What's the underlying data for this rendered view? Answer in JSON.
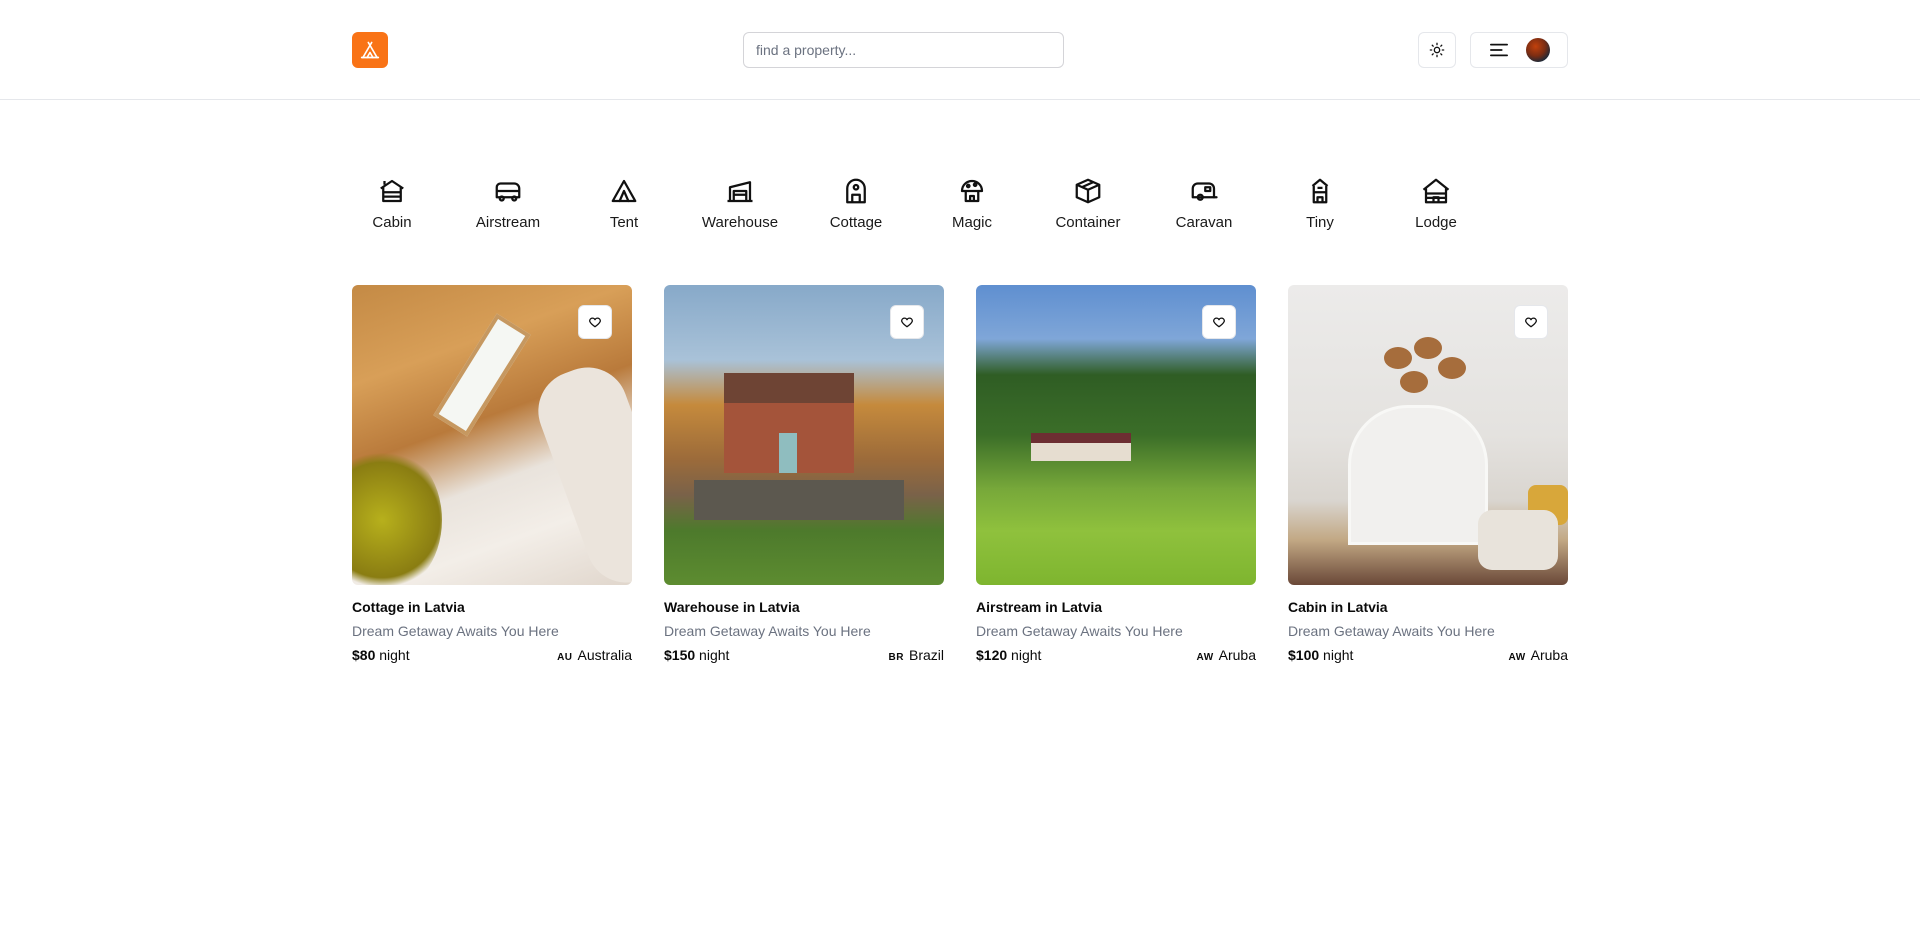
{
  "header": {
    "logo_icon": "tent-icon",
    "accent_color": "#f97316",
    "search": {
      "placeholder": "find a property..."
    },
    "theme_toggle_icon": "sun-icon",
    "menu_icon": "menu-lines-icon",
    "avatar_icon": "user-avatar"
  },
  "categories": [
    {
      "label": "Cabin",
      "icon": "cabin-icon"
    },
    {
      "label": "Airstream",
      "icon": "airstream-icon"
    },
    {
      "label": "Tent",
      "icon": "tent-icon"
    },
    {
      "label": "Warehouse",
      "icon": "warehouse-icon"
    },
    {
      "label": "Cottage",
      "icon": "cottage-icon"
    },
    {
      "label": "Magic",
      "icon": "magic-house-icon"
    },
    {
      "label": "Container",
      "icon": "container-icon"
    },
    {
      "label": "Caravan",
      "icon": "caravan-icon"
    },
    {
      "label": "Tiny",
      "icon": "tiny-house-icon"
    },
    {
      "label": "Lodge",
      "icon": "lodge-icon"
    }
  ],
  "properties": [
    {
      "title": "Cottage in Latvia",
      "tagline": "Dream Getaway Awaits You Here",
      "price": "$80",
      "price_unit": "night",
      "country_code": "AU",
      "country": "Australia",
      "favorite_icon": "heart-icon"
    },
    {
      "title": "Warehouse in Latvia",
      "tagline": "Dream Getaway Awaits You Here",
      "price": "$150",
      "price_unit": "night",
      "country_code": "BR",
      "country": "Brazil",
      "favorite_icon": "heart-icon"
    },
    {
      "title": "Airstream in Latvia",
      "tagline": "Dream Getaway Awaits You Here",
      "price": "$120",
      "price_unit": "night",
      "country_code": "AW",
      "country": "Aruba",
      "favorite_icon": "heart-icon"
    },
    {
      "title": "Cabin in Latvia",
      "tagline": "Dream Getaway Awaits You Here",
      "price": "$100",
      "price_unit": "night",
      "country_code": "AW",
      "country": "Aruba",
      "favorite_icon": "heart-icon"
    }
  ]
}
